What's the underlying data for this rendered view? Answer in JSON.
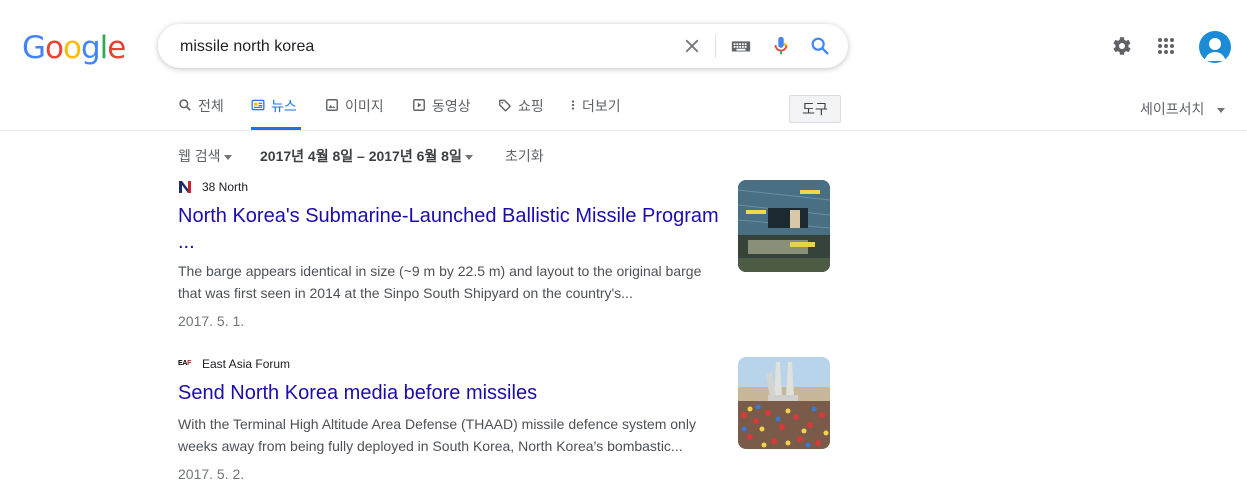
{
  "logo": "Google",
  "search": {
    "value": "missile north korea"
  },
  "tabs": [
    {
      "label": "전체",
      "icon": "search-icon"
    },
    {
      "label": "뉴스",
      "icon": "news-icon"
    },
    {
      "label": "이미지",
      "icon": "image-icon"
    },
    {
      "label": "동영상",
      "icon": "video-icon"
    },
    {
      "label": "쇼핑",
      "icon": "tag-icon"
    },
    {
      "label": "더보기",
      "icon": "more-vert-icon"
    }
  ],
  "tools_label": "도구",
  "safesearch_label": "세이프서치",
  "filters": {
    "type": "웹 검색",
    "date_range": "2017년 4월 8일 – 2017년 6월 8일",
    "reset": "초기화"
  },
  "results": [
    {
      "source": "38 North",
      "title_line1": "North Korea's Submarine-Launched Ballistic Missile Program",
      "title_line2": "...",
      "snippet_line1": "The barge appears identical in size (~9 m by 22.5 m) and layout to the original barge",
      "snippet_line2": "that was first seen in 2014 at the Sinpo South Shipyard on the country's...",
      "date": "2017. 5. 1."
    },
    {
      "source": "East Asia Forum",
      "favicon_text": "EAF",
      "title_line1": "Send North Korea media before missiles",
      "snippet_line1": "With the Terminal High Altitude Area Defense (THAAD) missile defence system only",
      "snippet_line2": "weeks away from being fully deployed in South Korea, North Korea's bombastic...",
      "date": "2017. 5. 2."
    }
  ],
  "colors": {
    "link": "#1a0dab",
    "accent": "#1a73e8",
    "logo_blue": "#4285f4",
    "logo_red": "#ea4335",
    "logo_yellow": "#fbbc05",
    "logo_green": "#34a853"
  }
}
